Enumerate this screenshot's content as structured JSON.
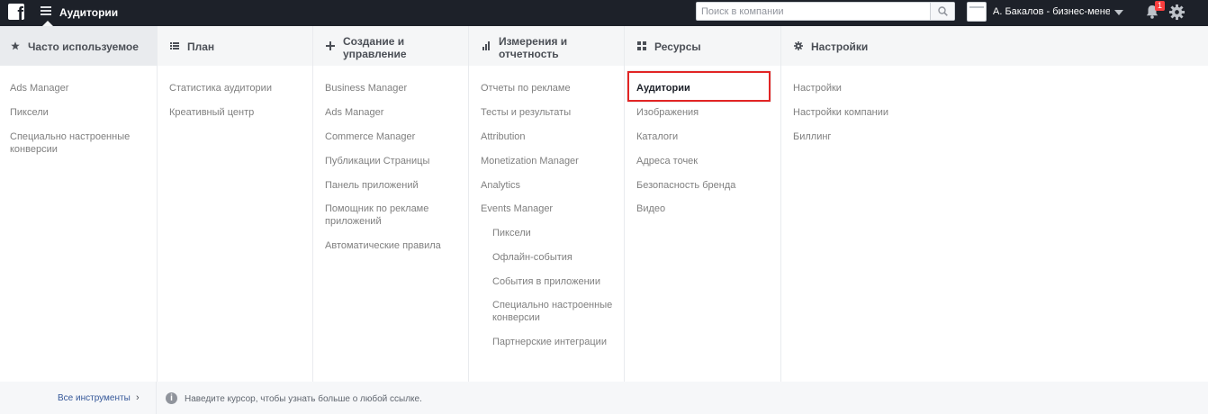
{
  "topbar": {
    "app_title": "Аудитории",
    "search_placeholder": "Поиск в компании",
    "account_name": "А. Бакалов - бизнес-менедж...",
    "notification_count": "1"
  },
  "columns": [
    {
      "header": "Часто используемое",
      "icon": "star-icon",
      "items": [
        "Ads Manager",
        "Пиксели",
        "Специально настроенные конверсии"
      ]
    },
    {
      "header": "План",
      "icon": "list-icon",
      "items": [
        "Статистика аудитории",
        "Креативный центр"
      ]
    },
    {
      "header": "Создание и управление",
      "icon": "plus-icon",
      "items": [
        "Business Manager",
        "Ads Manager",
        "Commerce Manager",
        "Публикации Страницы",
        "Панель приложений",
        "Помощник по рекламе приложений",
        "Автоматические правила"
      ]
    },
    {
      "header": "Измерения и отчетность",
      "icon": "bar-chart-icon",
      "items": [
        "Отчеты по рекламе",
        "Тесты и результаты",
        "Attribution",
        "Monetization Manager",
        "Analytics",
        "Events Manager"
      ],
      "subitems": [
        "Пиксели",
        "Офлайн-события",
        "События в приложении",
        "Специально настроенные конверсии",
        "Партнерские интеграции"
      ]
    },
    {
      "header": "Ресурсы",
      "icon": "grid-icon",
      "items": [
        "Аудитории",
        "Изображения",
        "Каталоги",
        "Адреса точек",
        "Безопасность бренда",
        "Видео"
      ]
    },
    {
      "header": "Настройки",
      "icon": "gear-icon",
      "items": [
        "Настройки",
        "Настройки компании",
        "Биллинг"
      ]
    }
  ],
  "footer": {
    "all_tools": "Все инструменты",
    "hint": "Наведите курсор, чтобы узнать больше о любой ссылке."
  },
  "colors": {
    "topbar": "#1d2129",
    "highlight": "#e22525",
    "link": "#7f7f7f",
    "active_link": "#1d2129"
  }
}
